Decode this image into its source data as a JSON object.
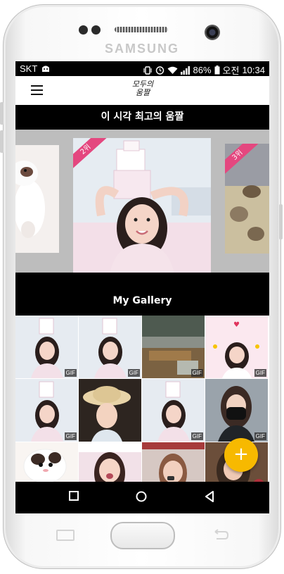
{
  "device": {
    "brand": "SAMSUNG"
  },
  "status_bar": {
    "carrier": "SKT",
    "battery": "86%",
    "ampm": "오전",
    "time": "10:34"
  },
  "app_bar": {
    "logo_line1": "모두의",
    "logo_line2": "움짤"
  },
  "trending": {
    "title": "이 시각 최고의 움짤",
    "slides": [
      {
        "rank": ""
      },
      {
        "rank": "2위"
      },
      {
        "rank": "3위"
      }
    ]
  },
  "gallery": {
    "title": "My Gallery",
    "badge": "GIF",
    "items": [
      {
        "badge": "GIF"
      },
      {
        "badge": "GIF"
      },
      {
        "badge": "GIF"
      },
      {
        "badge": "GIF"
      },
      {
        "badge": "GIF"
      },
      {
        "badge": ""
      },
      {
        "badge": "GIF"
      },
      {
        "badge": "GIF"
      },
      {
        "badge": ""
      },
      {
        "badge": ""
      },
      {
        "badge": ""
      },
      {
        "badge": ""
      }
    ]
  },
  "fab": {
    "label": "+"
  },
  "colors": {
    "accent": "#f7b900",
    "ribbon": "#e4477f",
    "header": "#000000"
  }
}
